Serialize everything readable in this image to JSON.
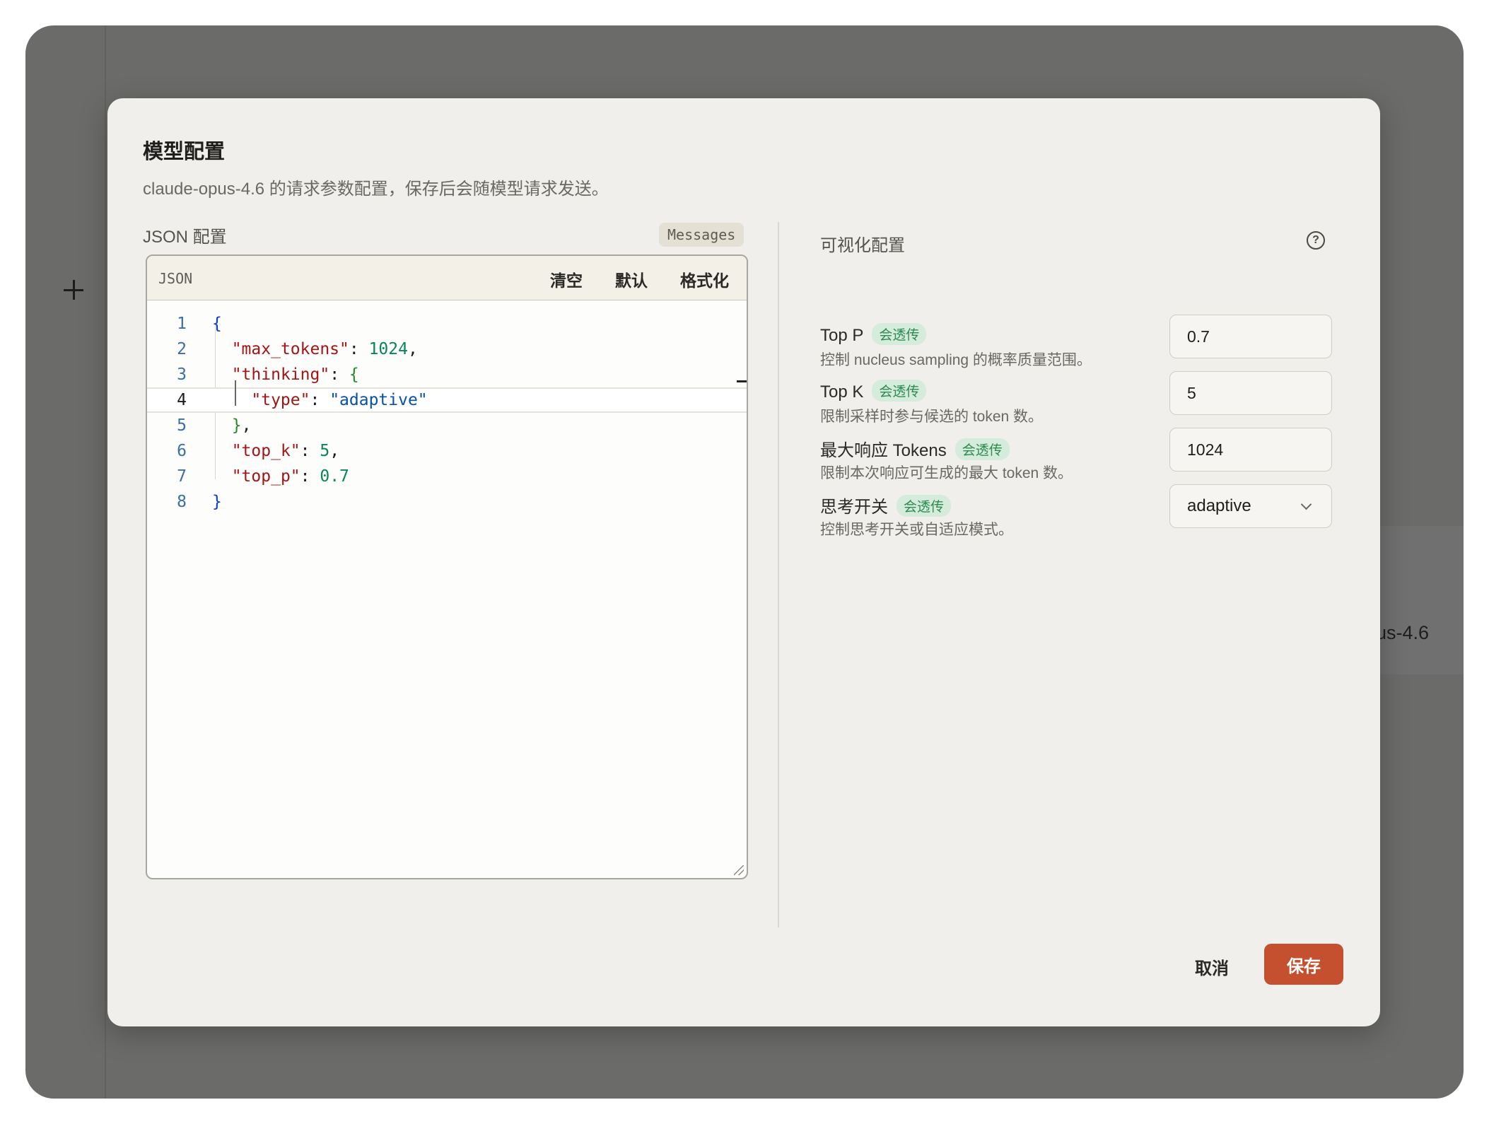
{
  "background": {
    "model_text": "us-4.6"
  },
  "dialog": {
    "title": "模型配置",
    "subtitle": "claude-opus-4.6 的请求参数配置，保存后会随模型请求发送。",
    "cancel_label": "取消",
    "save_label": "保存",
    "accent_color": "#c4502f"
  },
  "json_panel": {
    "label": "JSON 配置",
    "badge": "Messages",
    "toolbar_label": "JSON",
    "toolbar_buttons": [
      "清空",
      "默认",
      "格式化"
    ],
    "lines": [
      {
        "num": "1",
        "parts": [
          [
            "b1",
            "{"
          ]
        ]
      },
      {
        "num": "2",
        "parts": [
          [
            "p",
            "  "
          ],
          [
            "k",
            "\"max_tokens\""
          ],
          [
            "p",
            ": "
          ],
          [
            "n",
            "1024"
          ],
          [
            "p",
            ","
          ]
        ]
      },
      {
        "num": "3",
        "parts": [
          [
            "p",
            "  "
          ],
          [
            "k",
            "\"thinking\""
          ],
          [
            "p",
            ": "
          ],
          [
            "b2",
            "{"
          ]
        ]
      },
      {
        "num": "4",
        "parts": [
          [
            "p",
            "    "
          ],
          [
            "k",
            "\"type\""
          ],
          [
            "p",
            ": "
          ],
          [
            "s",
            "\"adaptive\""
          ]
        ]
      },
      {
        "num": "5",
        "parts": [
          [
            "p",
            "  "
          ],
          [
            "b2",
            "}"
          ],
          [
            "p",
            ","
          ]
        ]
      },
      {
        "num": "6",
        "parts": [
          [
            "p",
            "  "
          ],
          [
            "k",
            "\"top_k\""
          ],
          [
            "p",
            ": "
          ],
          [
            "n",
            "5"
          ],
          [
            "p",
            ","
          ]
        ]
      },
      {
        "num": "7",
        "parts": [
          [
            "p",
            "  "
          ],
          [
            "k",
            "\"top_p\""
          ],
          [
            "p",
            ": "
          ],
          [
            "n",
            "0.7"
          ]
        ]
      },
      {
        "num": "8",
        "parts": [
          [
            "b1",
            "}"
          ]
        ]
      }
    ],
    "active_line": 4
  },
  "viz_panel": {
    "label": "可视化配置",
    "help_icon": "question-circle-icon",
    "params": [
      {
        "name": "Top P",
        "badge": "会透传",
        "desc": "控制 nucleus sampling 的概率质量范围。",
        "value": "0.7",
        "type": "input"
      },
      {
        "name": "Top K",
        "badge": "会透传",
        "desc": "限制采样时参与候选的 token 数。",
        "value": "5",
        "type": "input"
      },
      {
        "name": "最大响应 Tokens",
        "badge": "会透传",
        "desc": "限制本次响应可生成的最大 token 数。",
        "value": "1024",
        "type": "input"
      },
      {
        "name": "思考开关",
        "badge": "会透传",
        "desc": "控制思考开关或自适应模式。",
        "value": "adaptive",
        "type": "select"
      }
    ]
  }
}
